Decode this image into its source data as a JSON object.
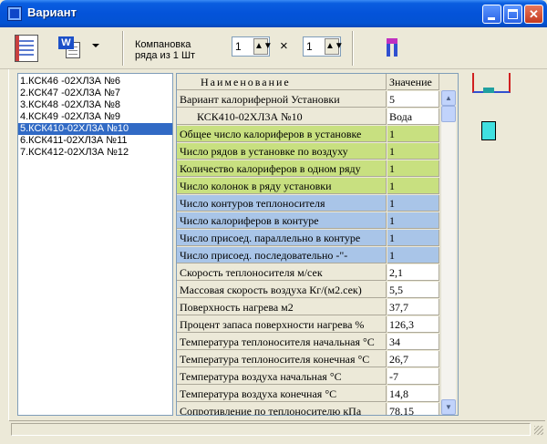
{
  "window": {
    "title": "Вариант"
  },
  "toolbar": {
    "layout_label": "Компановка",
    "rows_label": "ряда из  1 Шт",
    "spin1_value": "1",
    "spin2_value": "1",
    "times_symbol": "×"
  },
  "variants": [
    {
      "label": "1.КСК46 -02ХЛ3А №6",
      "selected": false
    },
    {
      "label": "2.КСК47 -02ХЛ3А №7",
      "selected": false
    },
    {
      "label": "3.КСК48 -02ХЛ3А №8",
      "selected": false
    },
    {
      "label": "4.КСК49 -02ХЛ3А №9",
      "selected": false
    },
    {
      "label": "5.КСК410-02ХЛ3А №10",
      "selected": true
    },
    {
      "label": "6.КСК411-02ХЛ3А №11",
      "selected": false
    },
    {
      "label": "7.КСК412-02ХЛ3А №12",
      "selected": false
    }
  ],
  "grid": {
    "header_name": "Наименование",
    "header_value": "Значение",
    "rows": [
      {
        "name": "Вариант калориферной Установки",
        "value": "5",
        "color": "white"
      },
      {
        "name": "КСК410-02ХЛ3А №10",
        "value": "Вода",
        "color": "white",
        "indent": true
      },
      {
        "name": "Общее число калориферов в установке",
        "value": "1",
        "color": "green"
      },
      {
        "name": "Число рядов в установке  по воздуху",
        "value": "1",
        "color": "green"
      },
      {
        "name": "Количество калориферов в одном ряду",
        "value": "1",
        "color": "green"
      },
      {
        "name": "Число колонок в ряду установки",
        "value": "1",
        "color": "green"
      },
      {
        "name": "Число контуров  теплоносителя",
        "value": "1",
        "color": "blue"
      },
      {
        "name": "Число калориферов в контуре",
        "value": "1",
        "color": "blue"
      },
      {
        "name": "Число присоед. параллельно в контуре",
        "value": "1",
        "color": "blue"
      },
      {
        "name": "Число присоед. последовательно  -\"-",
        "value": "1",
        "color": "blue"
      },
      {
        "name": "Скорость теплоносителя          м/сек",
        "value": "2,1",
        "color": "white"
      },
      {
        "name": "Массовая скорость воздуха  Кг/(м2.сек)",
        "value": "5,5",
        "color": "white"
      },
      {
        "name": "Поверхность нагрева                м2",
        "value": "37,7",
        "color": "white"
      },
      {
        "name": "Процент запаса поверхности нагрева  %",
        "value": "126,3",
        "color": "white"
      },
      {
        "name": "Температура теплоносителя начальная °С",
        "value": "34",
        "color": "white"
      },
      {
        "name": "Температура теплоносителя конечная  °С",
        "value": "26,7",
        "color": "white"
      },
      {
        "name": "Температура воздуха начальная       °С",
        "value": "-7",
        "color": "white"
      },
      {
        "name": "Температура воздуха конечная        °С",
        "value": "14,8",
        "color": "white"
      },
      {
        "name": "Сопротивление по теплоносителю   кПа",
        "value": "78,15",
        "color": "white"
      }
    ]
  },
  "colors": {
    "green_row": "#c8e080",
    "blue_row": "#a9c5e8",
    "selection": "#316ac5"
  }
}
